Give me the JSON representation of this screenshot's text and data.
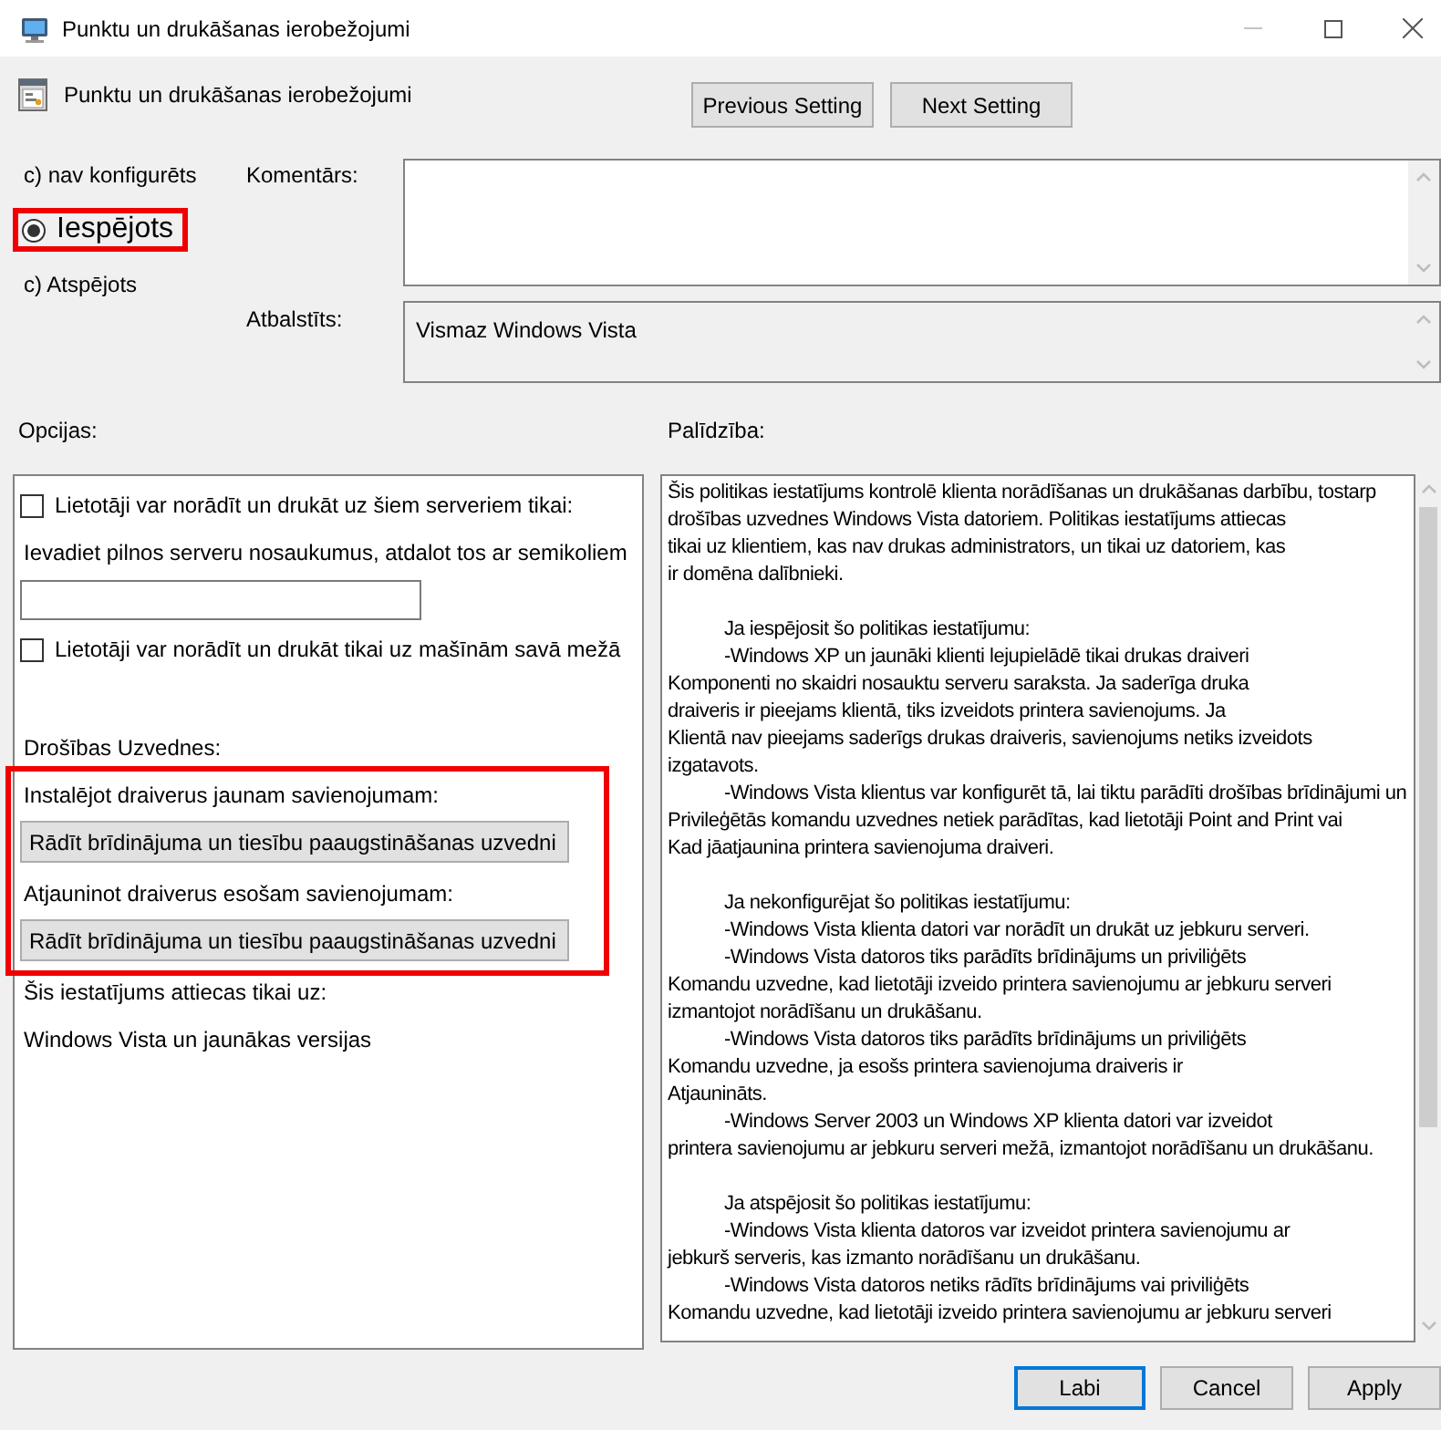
{
  "window": {
    "title": "Punktu un drukāšanas ierobežojumi"
  },
  "header": {
    "title": "Punktu un drukāšanas ierobežojumi",
    "buttons": [
      "Previous Setting",
      "Next Setting"
    ]
  },
  "state_options": [
    {
      "label": "c) nav konfigurēts",
      "selected": false,
      "highlighted": false
    },
    {
      "label": "Iespējots",
      "selected": true,
      "highlighted": true
    },
    {
      "label": "c) Atspējots",
      "selected": false,
      "highlighted": false
    }
  ],
  "comment": {
    "label": "Komentārs:"
  },
  "supported_on": {
    "label": "Atbalstīts:",
    "value": "Vismaz Windows Vista"
  },
  "options": {
    "label": "Opcijas:",
    "items": [
      {
        "kind": "checkbox",
        "label": "Lietotāji var norādīt un drukāt uz šiem serveriem tikai:",
        "checked": false
      },
      {
        "kind": "text",
        "text": "Ievadiet pilnos serveru nosaukumus, atdalot tos ar semikoliem"
      },
      {
        "kind": "input"
      },
      {
        "kind": "checkbox",
        "label": "Lietotāji var norādīt un drukāt tikai uz mašīnām savā mežā",
        "checked": false
      },
      {
        "kind": "section_title",
        "text": "Drošības Uzvednes:"
      },
      {
        "kind": "group",
        "highlighted": true,
        "items": [
          {
            "kind": "text",
            "text": "Instalējot draiverus jaunam savienojumam:"
          },
          {
            "kind": "dropdown",
            "value": "Rādīt brīdinājuma un tiesību paaugstināšanas uzvedni"
          },
          {
            "kind": "text",
            "text": "Atjauninot draiverus esošam savienojumam:"
          },
          {
            "kind": "dropdown",
            "value": "Rādīt brīdinājuma un tiesību paaugstināšanas uzvedni"
          }
        ]
      },
      {
        "kind": "text",
        "text": "Šis iestatījums attiecas tikai uz:"
      },
      {
        "kind": "text",
        "text": "Windows Vista un jaunākas versijas"
      }
    ]
  },
  "help": {
    "label": "Palīdzība:",
    "paragraphs": [
      "Šis politikas iestatījums kontrolē klienta norādīšanas un drukāšanas darbību, tostarp drošības uzvednes Windows Vista datoriem. Politikas iestatījums attiecas\ntikai uz klientiem, kas nav drukas administrators, un tikai uz datoriem, kas\nir domēna dalībnieki.",
      "\tJa iespējosit šo politikas iestatījumu:\n\t-Windows XP un jaunāki klienti lejupielādē tikai drukas draiveri\nKomponenti no skaidri nosauktu serveru saraksta. Ja saderīga druka\ndraiveris ir pieejams klientā, tiks izveidots printera savienojums. Ja\nKlientā nav pieejams saderīgs drukas draiveris, savienojums netiks izveidots\nizgatavots.\n\t-Windows Vista klientus var konfigurēt tā, lai tiktu parādīti drošības brīdinājumi un\nPrivileģētās komandu uzvednes netiek parādītas, kad lietotāji Point and Print vai\nKad jāatjaunina printera savienojuma draiveri.",
      "\tJa nekonfigurējat šo politikas iestatījumu:\n\t-Windows Vista klienta datori var norādīt un drukāt uz jebkuru serveri.\n\t-Windows Vista datoros tiks parādīts brīdinājums un priviliģēts\nKomandu uzvedne, kad lietotāji izveido printera savienojumu ar jebkuru serveri\nizmantojot norādīšanu un drukāšanu.\n\t-Windows Vista datoros tiks parādīts brīdinājums un priviliģēts\nKomandu uzvedne, ja esošs printera savienojuma draiveris ir\nAtjaunināts.\n\t-Windows Server 2003 un Windows XP klienta datori var izveidot\nprintera savienojumu ar jebkuru serveri mežā, izmantojot norādīšanu un drukāšanu.",
      "\tJa atspējosit šo politikas iestatījumu:\n\t-Windows Vista klienta datoros var izveidot printera savienojumu ar\njebkurš serveris, kas izmanto norādīšanu un drukāšanu.\n\t-Windows Vista datoros netiks rādīts brīdinājums vai priviliģēts\nKomandu uzvedne, kad lietotāji izveido printera savienojumu ar jebkuru serveri"
    ]
  },
  "footer_buttons": [
    {
      "label": "Labi",
      "default": true
    },
    {
      "label": "Cancel",
      "default": false
    },
    {
      "label": "Apply",
      "default": false
    }
  ]
}
